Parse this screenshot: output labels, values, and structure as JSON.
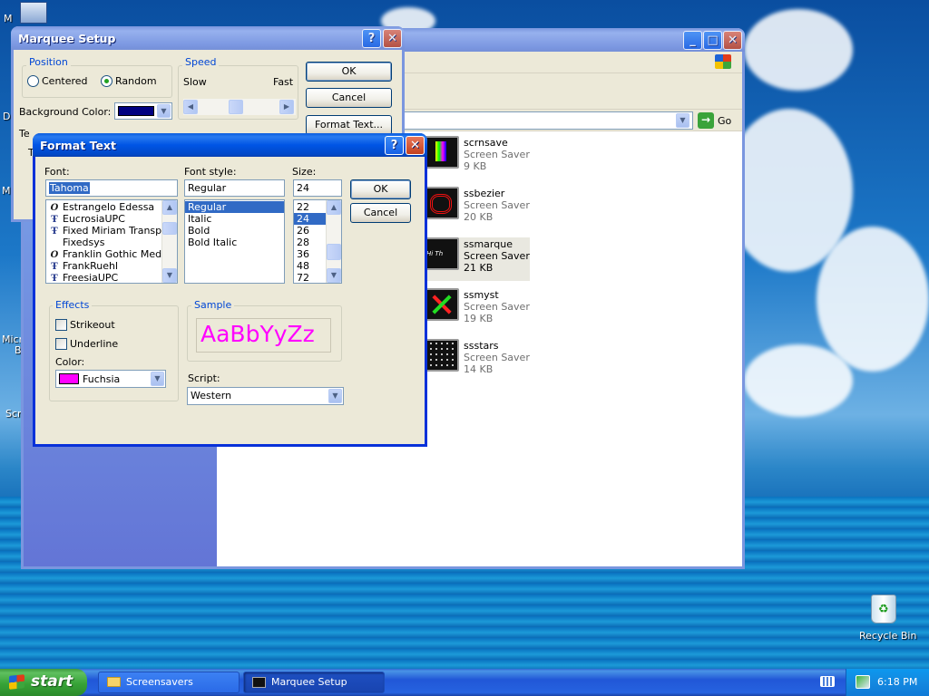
{
  "desktop": {
    "icons": [
      {
        "label": "M"
      },
      {
        "label": "D"
      },
      {
        "label": "Mi"
      },
      {
        "label": "Micr"
      },
      {
        "label": "B"
      },
      {
        "label": "Scr"
      },
      {
        "label": "Recycle Bin"
      }
    ]
  },
  "explorer": {
    "go_label": "Go",
    "files": [
      {
        "name": "scrnsave",
        "type": "Screen Saver",
        "size": "9 KB"
      },
      {
        "name": "ssbezier",
        "type": "Screen Saver",
        "size": "20 KB"
      },
      {
        "name": "ssmarque",
        "type": "Screen Saver",
        "size": "21 KB"
      },
      {
        "name": "ssmyst",
        "type": "Screen Saver",
        "size": "19 KB"
      },
      {
        "name": "ssstars",
        "type": "Screen Saver",
        "size": "14 KB"
      }
    ],
    "thumb_text": "Hi Th"
  },
  "marquee": {
    "title": "Marquee Setup",
    "position_label": "Position",
    "centered_label": "Centered",
    "random_label": "Random",
    "speed_label": "Speed",
    "slow_label": "Slow",
    "fast_label": "Fast",
    "bg_color_label": "Background Color:",
    "text_label_partial": "Te",
    "text_label_partial2": "T",
    "ok": "OK",
    "cancel": "Cancel",
    "format_text": "Format Text...",
    "bg_color": "#000080"
  },
  "format": {
    "title": "Format Text",
    "font_label": "Font:",
    "font_value": "Tahoma",
    "fonts": [
      {
        "name": "Estrangelo Edessa",
        "icon": "opentype-icon"
      },
      {
        "name": "EucrosiaUPC",
        "icon": "truetype-icon"
      },
      {
        "name": "Fixed Miriam Transparent",
        "icon": "truetype-icon"
      },
      {
        "name": "Fixedsys",
        "icon": ""
      },
      {
        "name": "Franklin Gothic Medium",
        "icon": "opentype-icon"
      },
      {
        "name": "FrankRuehl",
        "icon": "truetype-icon"
      },
      {
        "name": "FreesiaUPC",
        "icon": "truetype-icon"
      }
    ],
    "style_label": "Font style:",
    "style_value": "Regular",
    "styles": [
      "Regular",
      "Italic",
      "Bold",
      "Bold Italic"
    ],
    "size_label": "Size:",
    "size_value": "24",
    "sizes": [
      "22",
      "24",
      "26",
      "28",
      "36",
      "48",
      "72"
    ],
    "ok": "OK",
    "cancel": "Cancel",
    "effects_label": "Effects",
    "strikeout_label": "Strikeout",
    "underline_label": "Underline",
    "color_label": "Color:",
    "color_value": "Fuchsia",
    "color_hex": "#ff00ff",
    "sample_label": "Sample",
    "sample_text": "AaBbYyZz",
    "script_label": "Script:",
    "script_value": "Western"
  },
  "taskbar": {
    "start_label": "start",
    "tasks": [
      {
        "label": "Screensavers"
      },
      {
        "label": "Marquee Setup"
      }
    ],
    "clock": "6:18 PM"
  }
}
